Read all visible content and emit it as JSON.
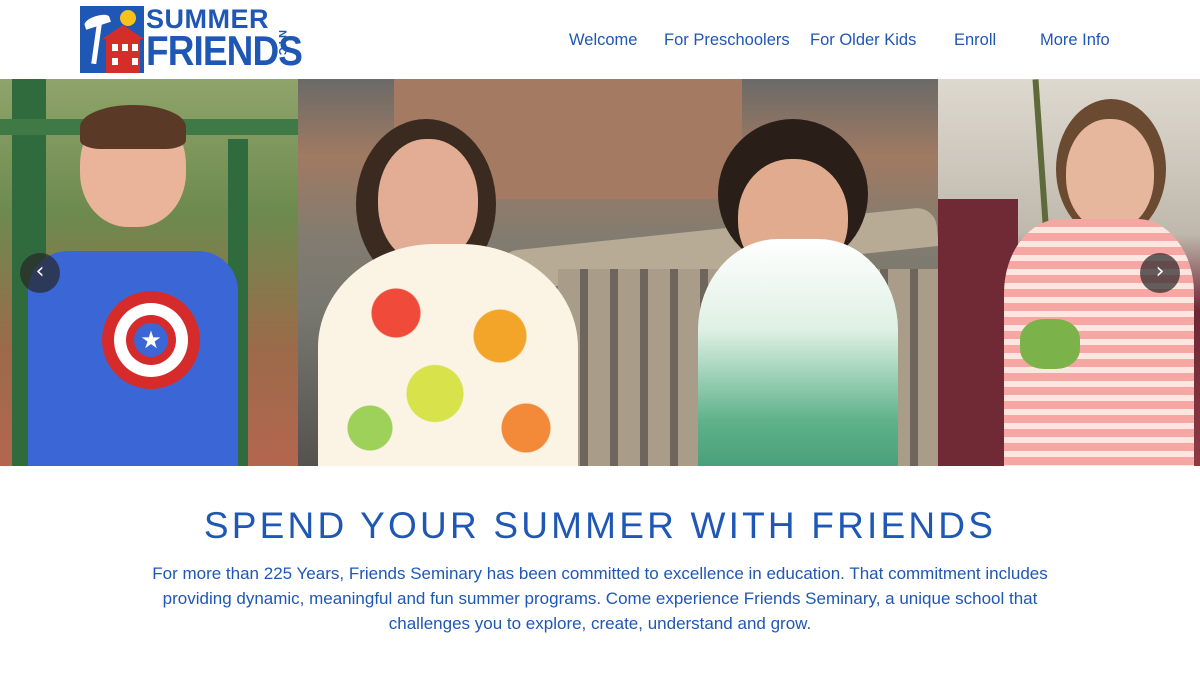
{
  "logo": {
    "line1": "SUMMER",
    "line2": "FRIENDS",
    "line3": "NYC"
  },
  "nav": {
    "items": [
      {
        "label": "Welcome"
      },
      {
        "label": "For Preschoolers"
      },
      {
        "label": "For Older Kids"
      },
      {
        "label": "Enroll"
      },
      {
        "label": "More Info"
      }
    ]
  },
  "carousel": {
    "prev_icon": "chevron-left-icon",
    "next_icon": "chevron-right-icon",
    "prev_glyph": "‹",
    "next_glyph": "›",
    "photos": [
      "boy-in-star-shirt-photo",
      "girl-in-polka-dot-towel-photo",
      "girl-with-towel-on-bench-photo",
      "girl-with-rope-swing-photo"
    ]
  },
  "main": {
    "headline": "SPEND YOUR SUMMER WITH FRIENDS",
    "intro_line1": "For more than 225 Years, Friends Seminary has been committed to excellence in education. That commitment includes",
    "intro_line2": "providing dynamic, meaningful and fun summer programs. Come experience Friends Seminary, a unique school that",
    "intro_line3": "challenges you to explore, create, understand and grow."
  },
  "colors": {
    "brand_blue": "#1f57b5",
    "brand_red": "#d32e2a",
    "sun_yellow": "#f6c21b"
  }
}
